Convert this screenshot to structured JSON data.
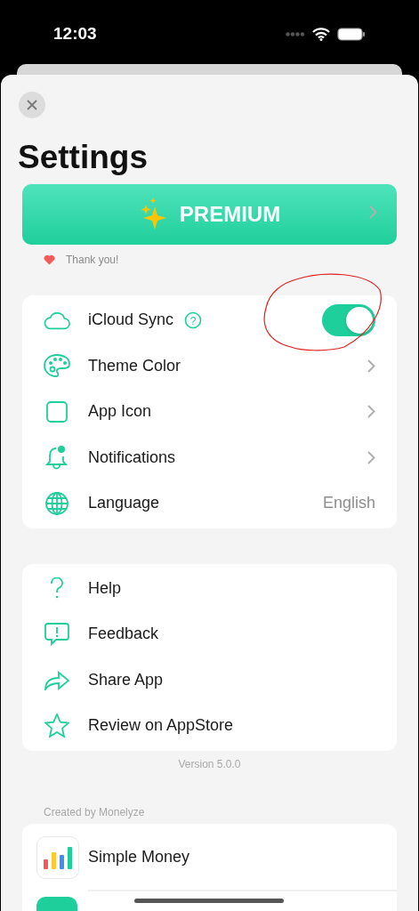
{
  "status_bar": {
    "time": "12:03"
  },
  "title": "Settings",
  "premium": {
    "label": "PREMIUM"
  },
  "thanks": "Thank you!",
  "settings": [
    {
      "label": "iCloud Sync",
      "kind": "toggle",
      "help": "?",
      "on": true
    },
    {
      "label": "Theme Color",
      "kind": "chevron"
    },
    {
      "label": "App Icon",
      "kind": "chevron"
    },
    {
      "label": "Notifications",
      "kind": "chevron"
    },
    {
      "label": "Language",
      "kind": "value",
      "value": "English"
    }
  ],
  "support": [
    {
      "label": "Help"
    },
    {
      "label": "Feedback"
    },
    {
      "label": "Share App"
    },
    {
      "label": "Review on AppStore"
    }
  ],
  "version": "Version 5.0.0",
  "created_by": "Created by Monelyze",
  "apps": [
    {
      "label": "Simple Money"
    }
  ]
}
